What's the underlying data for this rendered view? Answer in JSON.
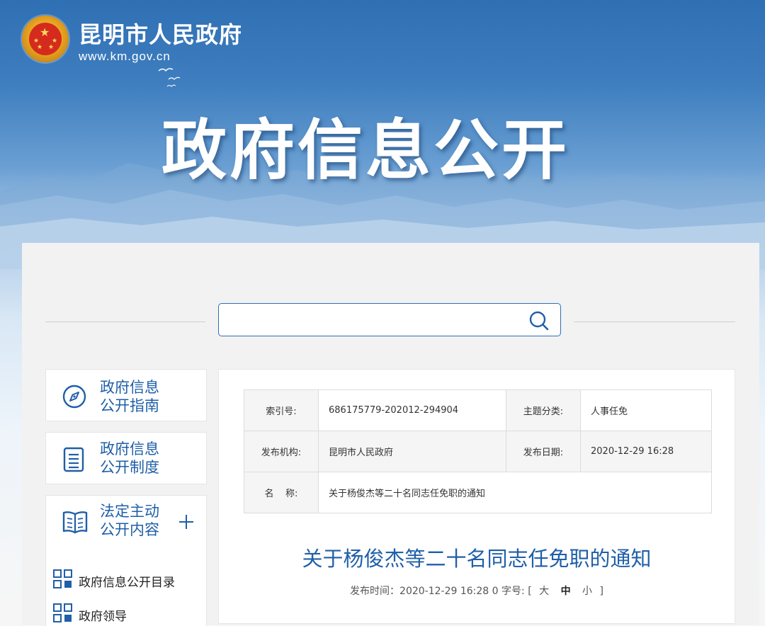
{
  "header": {
    "site_name": "昆明市人民政府",
    "site_url": "www.km.gov.cn",
    "banner_title": "政府信息公开"
  },
  "search": {
    "placeholder": "",
    "value": ""
  },
  "sidebar": {
    "cards": [
      {
        "line1": "政府信息",
        "line2": "公开指南",
        "icon": "compass-icon"
      },
      {
        "line1": "政府信息",
        "line2": "公开制度",
        "icon": "document-icon"
      },
      {
        "line1": "法定主动",
        "line2": "公开内容",
        "icon": "book-icon",
        "expandable": true
      }
    ],
    "sub_items": [
      {
        "label": "政府信息公开目录",
        "icon": "grid-icon"
      },
      {
        "label": "政府领导",
        "icon": "grid-icon"
      }
    ]
  },
  "meta": {
    "index_label": "索引号:",
    "index_value": "686175779-202012-294904",
    "topic_label": "主题分类:",
    "topic_value": "人事任免",
    "publisher_label": "发布机构:",
    "publisher_value": "昆明市人民政府",
    "date_label": "发布日期:",
    "date_value": "2020-12-29 16:28",
    "name_label": "名    称:",
    "name_value": "关于杨俊杰等二十名同志任免职的通知"
  },
  "article": {
    "title": "关于杨俊杰等二十名同志任免职的通知",
    "pub_prefix": "发布时间：",
    "pub_time": "2020-12-29 16:28",
    "views": "0",
    "font_size_label": "字号:",
    "bracket_open": "[",
    "size_large": "大",
    "size_medium": "中",
    "size_small": "小",
    "bracket_close": "]"
  },
  "colors": {
    "brand_blue": "#1f5fa8",
    "banner_blue": "#2f6fb3",
    "panel_bg": "#f2f2f2"
  }
}
